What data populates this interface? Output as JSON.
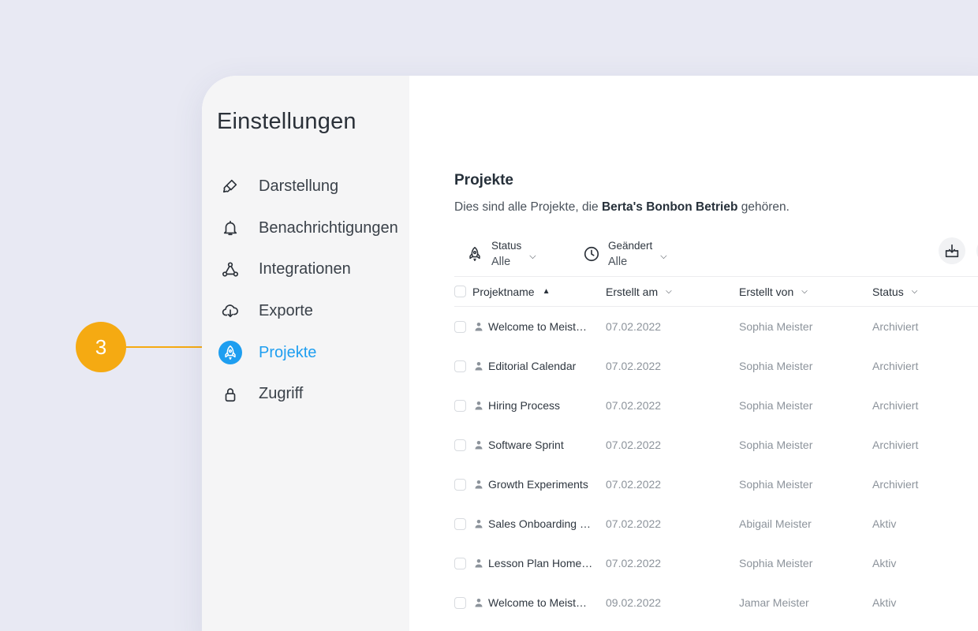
{
  "callout": {
    "number": "3"
  },
  "sidebar": {
    "title": "Einstellungen",
    "items": [
      {
        "label": "Darstellung",
        "icon": "paint-brush-icon"
      },
      {
        "label": "Benachrichtigungen",
        "icon": "bell-icon"
      },
      {
        "label": "Integrationen",
        "icon": "integrations-icon"
      },
      {
        "label": "Exporte",
        "icon": "cloud-download-icon"
      },
      {
        "label": "Projekte",
        "icon": "rocket-icon",
        "active": true
      },
      {
        "label": "Zugriff",
        "icon": "lock-icon"
      }
    ]
  },
  "main": {
    "title": "Projekte",
    "description_prefix": "Dies sind alle Projekte, die ",
    "description_owner": "Berta's Bonbon Betrieb",
    "description_suffix": " gehören.",
    "filters": {
      "status": {
        "label": "Status",
        "value": "Alle",
        "icon": "rocket-icon"
      },
      "changed": {
        "label": "Geändert",
        "value": "Alle",
        "icon": "clock-icon"
      }
    },
    "table": {
      "columns": {
        "name": "Projektname",
        "created_at": "Erstellt am",
        "created_by": "Erstellt von",
        "status": "Status"
      },
      "rows": [
        {
          "name": "Welcome to Meist…",
          "created_at": "07.02.2022",
          "created_by": "Sophia Meister",
          "status": "Archiviert"
        },
        {
          "name": "Editorial Calendar",
          "created_at": "07.02.2022",
          "created_by": "Sophia Meister",
          "status": "Archiviert"
        },
        {
          "name": "Hiring Process",
          "created_at": "07.02.2022",
          "created_by": "Sophia Meister",
          "status": "Archiviert"
        },
        {
          "name": "Software Sprint",
          "created_at": "07.02.2022",
          "created_by": "Sophia Meister",
          "status": "Archiviert"
        },
        {
          "name": "Growth Experiments",
          "created_at": "07.02.2022",
          "created_by": "Sophia Meister",
          "status": "Archiviert"
        },
        {
          "name": "Sales Onboarding …",
          "created_at": "07.02.2022",
          "created_by": "Abigail Meister",
          "status": "Aktiv"
        },
        {
          "name": "Lesson Plan Home…",
          "created_at": "07.02.2022",
          "created_by": "Sophia Meister",
          "status": "Aktiv"
        },
        {
          "name": "Welcome to Meist…",
          "created_at": "09.02.2022",
          "created_by": "Jamar Meister",
          "status": "Aktiv"
        }
      ]
    }
  },
  "colors": {
    "accent": "#1e9ef0",
    "callout": "#f5aa12",
    "background": "#e8e9f3"
  }
}
